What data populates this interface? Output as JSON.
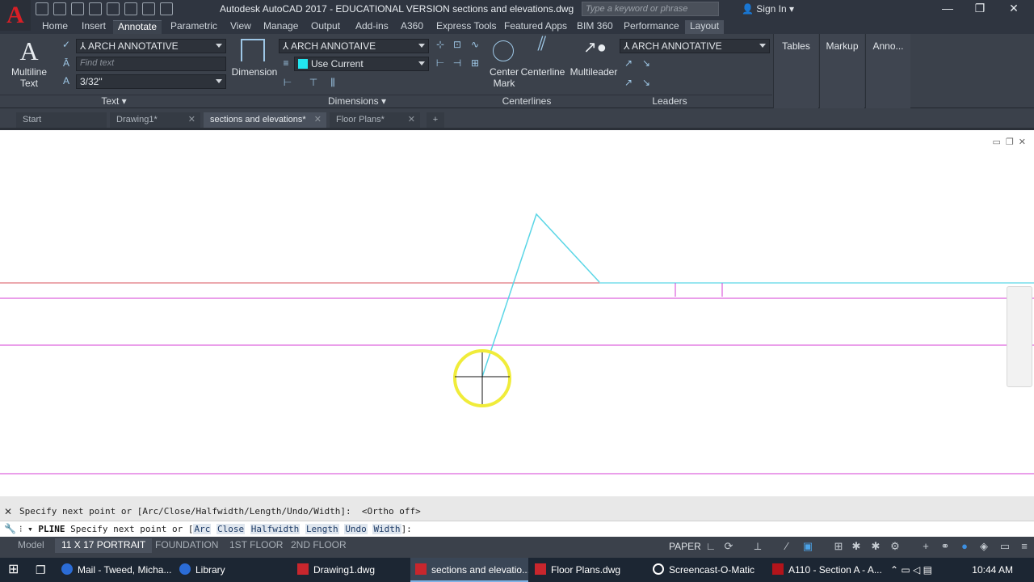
{
  "title_bar": {
    "title": "Autodesk AutoCAD 2017 - EDUCATIONAL VERSION    sections and elevations.dwg",
    "search_placeholder": "Type a keyword or phrase",
    "sign_in": "Sign In",
    "minimize": "—",
    "restore": "❐",
    "close": "✕"
  },
  "ribbon_tabs": [
    "Home",
    "Insert",
    "Annotate",
    "Parametric",
    "View",
    "Manage",
    "Output",
    "Add-ins",
    "A360",
    "Express Tools",
    "Featured Apps",
    "BIM 360",
    "Performance",
    "Layout"
  ],
  "ribbon": {
    "text_panel": {
      "multiline_label_1": "Multiline",
      "multiline_label_2": "Text",
      "text_style": "ARCH ANNOTATIVE",
      "find_text_placeholder": "Find text",
      "text_height": "3/32\"",
      "panel_title": "Text ▾"
    },
    "dimensions_panel": {
      "dimension_label": "Dimension",
      "dim_style": "ARCH ANNOTAIVE",
      "layer": "Use Current",
      "panel_title": "Dimensions ▾"
    },
    "centerlines_panel": {
      "center_mark_1": "Center",
      "center_mark_2": "Mark",
      "centerline": "Centerline",
      "panel_title": "Centerlines"
    },
    "leaders_panel": {
      "multileader": "Multileader",
      "mleader_style": "ARCH ANNOTATIVE",
      "panel_title": "Leaders"
    },
    "side_panels": [
      "Tables",
      "Markup",
      "Anno..."
    ]
  },
  "doc_tabs": [
    "Start",
    "Drawing1*",
    "sections and elevations*",
    "Floor Plans*"
  ],
  "doc_tab_add": "+",
  "command_line": {
    "history": "Specify next point or [Arc/Close/Halfwidth/Length/Undo/Width]:  <Ortho off>",
    "prompt_cmd": "PLINE",
    "prompt_text": " Specify next point or [",
    "options": [
      "Arc",
      "Close",
      "Halfwidth",
      "Length",
      "Undo",
      "Width"
    ],
    "prompt_end": "]:"
  },
  "layout_tabs": [
    "Model",
    "11 X 17 PORTRAIT",
    "FOUNDATION",
    "1ST FLOOR",
    "2ND FLOOR"
  ],
  "status_bar": {
    "space": "PAPER"
  },
  "taskbar": {
    "items": [
      "Mail - Tweed, Micha...",
      "Library",
      "Drawing1.dwg",
      "sections and elevatio...",
      "Floor Plans.dwg",
      "Screencast-O-Matic",
      "A110 - Section A - A..."
    ],
    "time": "10:44 AM"
  },
  "colors": {
    "cyan_line": "#5bd6e6",
    "magenta_line": "#d63fd6",
    "red_line": "#d9535e",
    "cursor_highlight": "#f0ec3a",
    "ribbon_bg": "#3b414b",
    "taskbar_bg": "#1c2633"
  }
}
